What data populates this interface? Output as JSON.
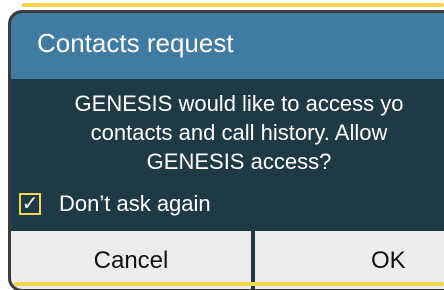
{
  "dialog": {
    "title": "Contacts request",
    "message_lines": [
      "GENESIS would like to access yo",
      "contacts and call history. Allow",
      "GENESIS access?"
    ],
    "checkbox": {
      "checked": true,
      "check_glyph": "✓",
      "label": "Don’t ask again"
    },
    "buttons": {
      "cancel": "Cancel",
      "ok": "OK"
    }
  },
  "colors": {
    "title_bar": "#3f7ba3",
    "body": "#1d3a46",
    "accent": "#f2d64b",
    "button": "#ececec"
  }
}
